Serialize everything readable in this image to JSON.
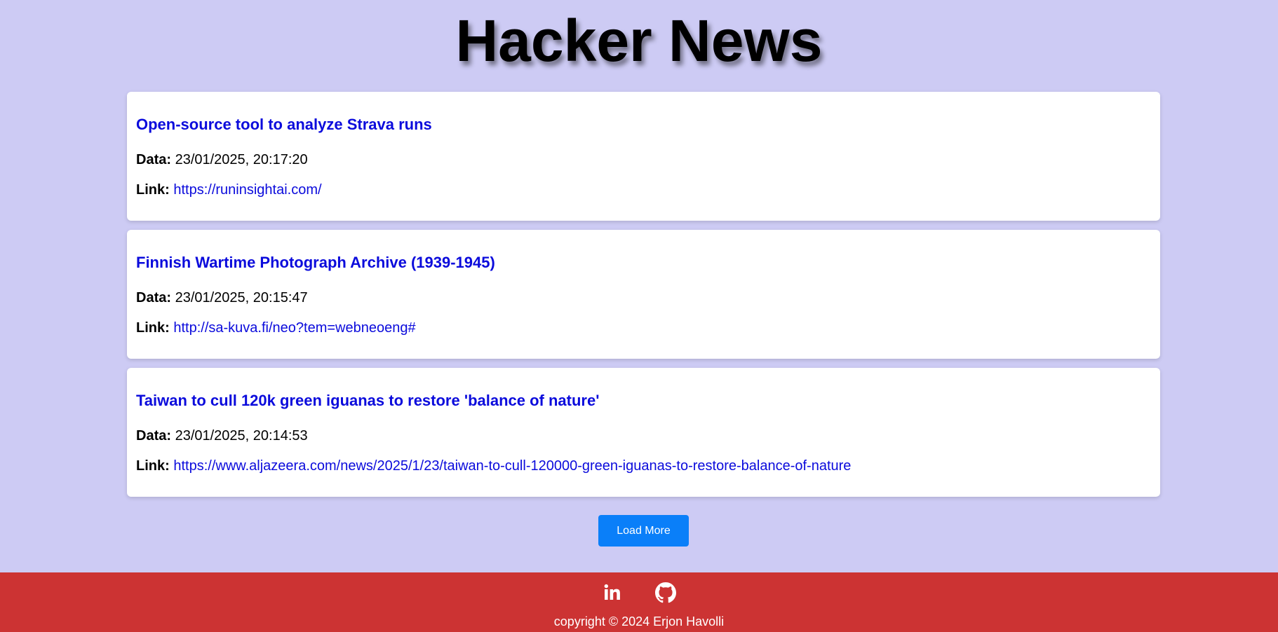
{
  "header": {
    "title": "Hacker News"
  },
  "stories": [
    {
      "title": "Open-source tool to analyze Strava runs",
      "date_label": "Data:",
      "date": "23/01/2025, 20:17:20",
      "link_label": "Link:",
      "url": "https://runinsightai.com/"
    },
    {
      "title": "Finnish Wartime Photograph Archive (1939-1945)",
      "date_label": "Data:",
      "date": "23/01/2025, 20:15:47",
      "link_label": "Link:",
      "url": "http://sa-kuva.fi/neo?tem=webneoeng#"
    },
    {
      "title": "Taiwan to cull 120k green iguanas to restore 'balance of nature'",
      "date_label": "Data:",
      "date": "23/01/2025, 20:14:53",
      "link_label": "Link:",
      "url": "https://www.aljazeera.com/news/2025/1/23/taiwan-to-cull-120000-green-iguanas-to-restore-balance-of-nature"
    }
  ],
  "actions": {
    "load_more_label": "Load More"
  },
  "footer": {
    "social_icons": [
      "linkedin-icon",
      "github-icon"
    ],
    "copyright": "copyright © 2024 Erjon Havolli"
  },
  "colors": {
    "background": "#cdcbf4",
    "link": "#0b0bdc",
    "button": "#0a7ff9",
    "footer": "#cc3333"
  }
}
